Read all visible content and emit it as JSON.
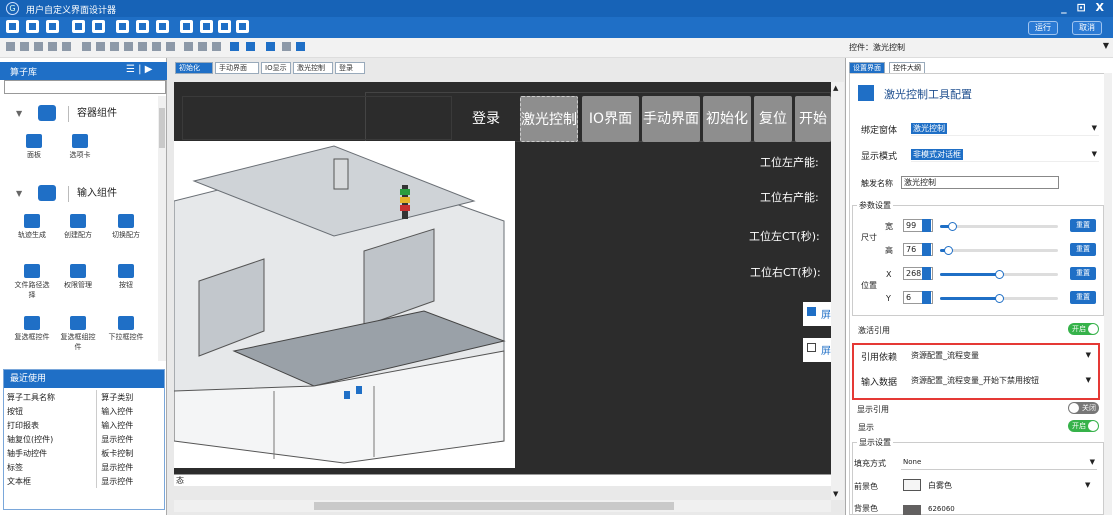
{
  "window": {
    "title": "用户自定义界面设计器",
    "controls": "_ ⊡ X"
  },
  "header_buttons": {
    "run": "运行",
    "cancel": "取消"
  },
  "control_selector": {
    "label": "控件：",
    "value": "激光控制"
  },
  "left_panel": {
    "title": "算子库",
    "sections": [
      {
        "label": "容器组件"
      },
      {
        "label": "输入组件"
      }
    ],
    "container_tiles": [
      {
        "label": "面板"
      },
      {
        "label": "选项卡"
      }
    ],
    "input_tiles": [
      {
        "label": "轨迹生成"
      },
      {
        "label": "创建配方"
      },
      {
        "label": "切换配方"
      },
      {
        "label": "文件路径选择"
      },
      {
        "label": "权限管理"
      },
      {
        "label": "按钮"
      },
      {
        "label": "复选框控件"
      },
      {
        "label": "复选框组控件"
      },
      {
        "label": "下拉框控件"
      }
    ],
    "recent": {
      "title": "最近使用",
      "columns": [
        "算子工具名称",
        "算子类别"
      ],
      "rows": [
        [
          "按钮",
          "输入控件"
        ],
        [
          "打印报表",
          "输入控件"
        ],
        [
          "轴复位(控件)",
          "显示控件"
        ],
        [
          "轴手动控件",
          "板卡控制"
        ],
        [
          "标签",
          "显示控件"
        ],
        [
          "文本框",
          "显示控件"
        ]
      ]
    }
  },
  "canvas": {
    "tabs": [
      "初始化",
      "手动界面",
      "IO显示",
      "激光控制",
      "登录"
    ],
    "nav_buttons": [
      "登录",
      "激光控制",
      "IO界面",
      "手动界面",
      "初始化",
      "复位",
      "开始"
    ],
    "production": [
      "工位左产能:",
      "工位右产能:",
      "工位左CT(秒):",
      "工位右CT(秒):"
    ],
    "checkbox_glyph": "屏",
    "bottom_text": "态"
  },
  "right_panel": {
    "tabs": [
      "设置界面",
      "控件大纲"
    ],
    "title": "激光控制工具配置",
    "bind_window": {
      "label": "绑定窗体",
      "value": "激光控制"
    },
    "display_mode": {
      "label": "显示模式",
      "value": "非模式对话框"
    },
    "trigger_name": {
      "label": "触发名称",
      "value": "激光控制"
    },
    "params": {
      "legend": "参数设置",
      "size_label": "尺寸",
      "pos_label": "位置",
      "width": {
        "label": "宽",
        "value": "99",
        "fraction": 0.1
      },
      "height": {
        "label": "高",
        "value": "76",
        "fraction": 0.07
      },
      "x": {
        "label": "X",
        "value": "268",
        "fraction": 0.5
      },
      "y": {
        "label": "Y",
        "value": "6",
        "fraction": 0.5
      },
      "reset": "重置"
    },
    "activate_ref": {
      "label": "激活引用",
      "state": "开启"
    },
    "ref_dep": {
      "label": "引用依赖",
      "value": "资源配置_流程变量"
    },
    "input_data": {
      "label": "输入数据",
      "value": "资源配置_流程变量_开始下禁用按钮"
    },
    "show_ref": {
      "label": "显示引用",
      "state": "关闭"
    },
    "show": {
      "label": "显示",
      "state": "开启"
    },
    "display": {
      "legend": "显示设置",
      "fill_mode": {
        "label": "填充方式",
        "value": "None"
      },
      "fg": {
        "label": "前景色",
        "value": "白雾色"
      },
      "bg": {
        "label": "背景色",
        "value": "626060"
      }
    }
  }
}
